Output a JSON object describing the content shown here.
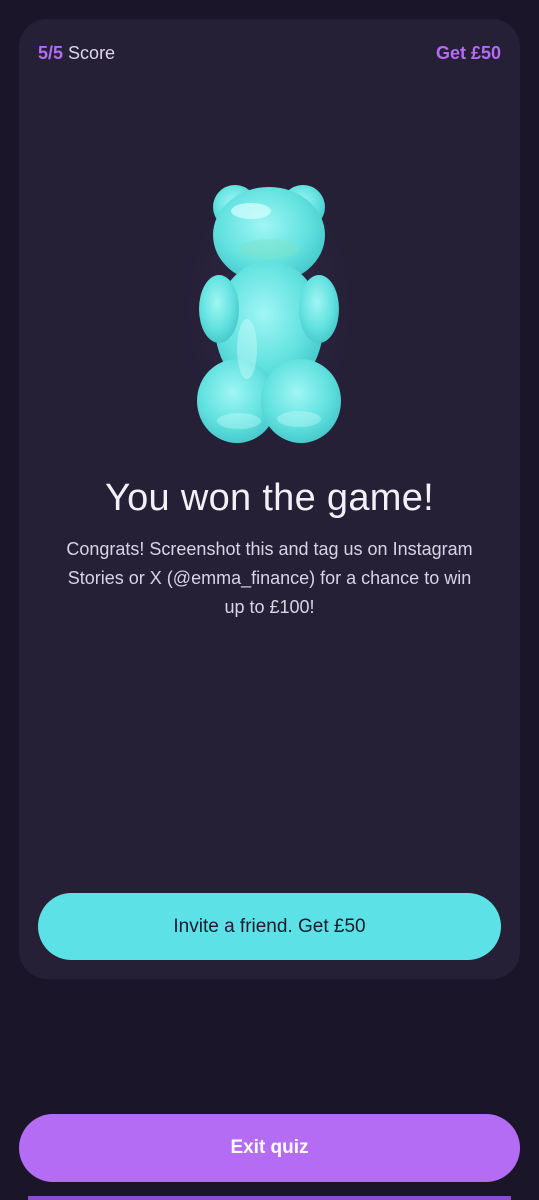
{
  "header": {
    "score_value": "5/5",
    "score_label": "Score",
    "get_link_label": "Get £50"
  },
  "illustration": {
    "icon": "gummy-bear-icon",
    "color": "#5fe0e2"
  },
  "result": {
    "headline": "You won the game!",
    "body": "Congrats! Screenshot this and tag us on Instagram Stories or X (@emma_finance) for a chance to win up to £100!"
  },
  "actions": {
    "invite_label": "Invite a friend. Get £50",
    "exit_label": "Exit quiz"
  },
  "colors": {
    "accent": "#b46cf4",
    "cta": "#5be1e6",
    "background": "#1b1529",
    "card": "#252036"
  }
}
